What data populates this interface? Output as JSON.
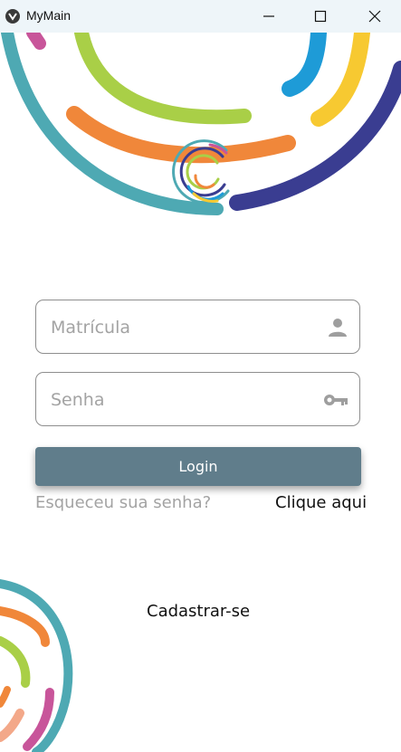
{
  "window": {
    "title": "MyMain",
    "controls": {
      "minimize": "minimize-icon",
      "maximize": "maximize-icon",
      "close": "close-icon"
    }
  },
  "form": {
    "username_placeholder": "Matrícula",
    "username_icon": "user-icon",
    "password_placeholder": "Senha",
    "password_icon": "key-icon",
    "login_label": "Login"
  },
  "links": {
    "forgot_label": "Esqueceu sua senha?",
    "click_here_label": "Clique aqui",
    "register_label": "Cadastrar-se"
  },
  "colors": {
    "button": "#607d8b",
    "ring_teal": "#4ea9b3",
    "ring_orange": "#f0873a",
    "ring_green": "#a9cf47",
    "ring_blue": "#1e9bd7",
    "ring_yellow": "#f7c931",
    "ring_navy": "#3a3d91",
    "ring_pink": "#c8559a"
  }
}
